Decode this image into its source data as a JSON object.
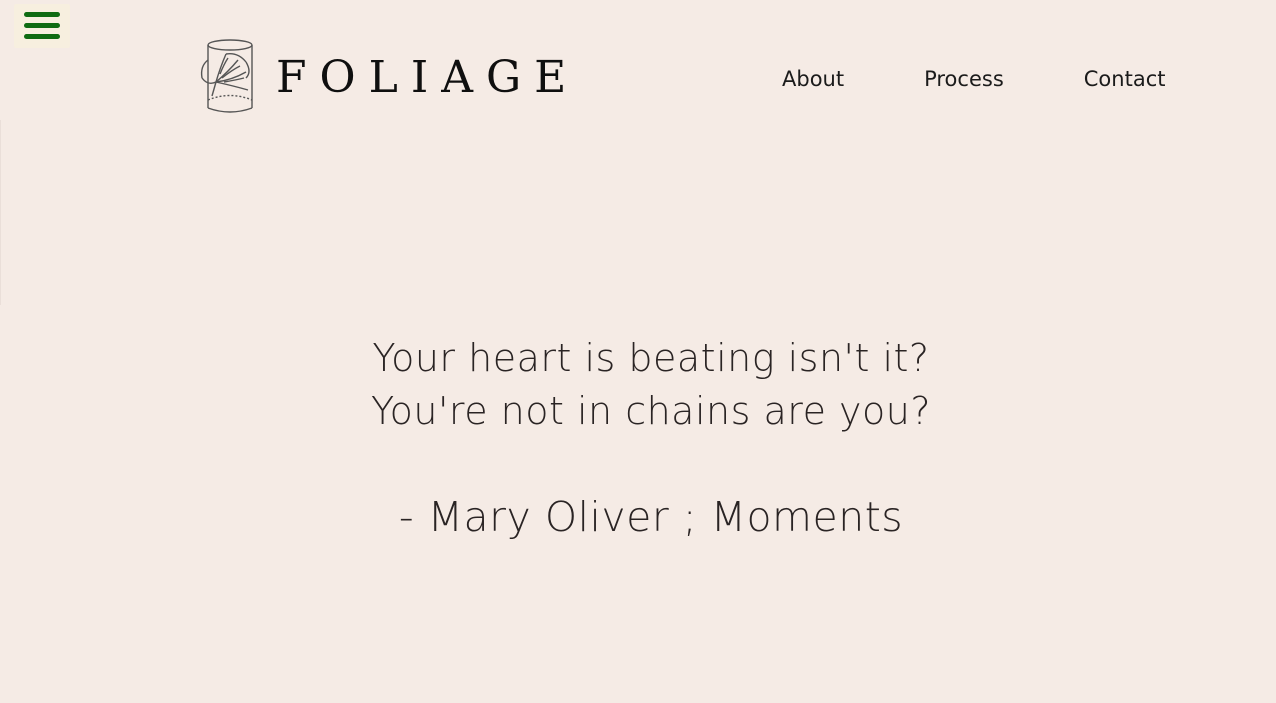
{
  "brand": {
    "name": "FOLIAGE",
    "logo_icon": "leaf-in-jar-icon"
  },
  "menu": {
    "icon": "hamburger-menu-icon",
    "accent_color": "#0f6b12"
  },
  "nav": {
    "items": [
      {
        "label": "About"
      },
      {
        "label": "Process"
      },
      {
        "label": "Contact"
      }
    ]
  },
  "hero": {
    "quote_lines": [
      "Your heart is beating isn't it?",
      "You're not in chains are you?"
    ],
    "attribution": "- Mary Oliver ; Moments"
  },
  "colors": {
    "background": "#f5ebe5",
    "text": "#111111"
  }
}
